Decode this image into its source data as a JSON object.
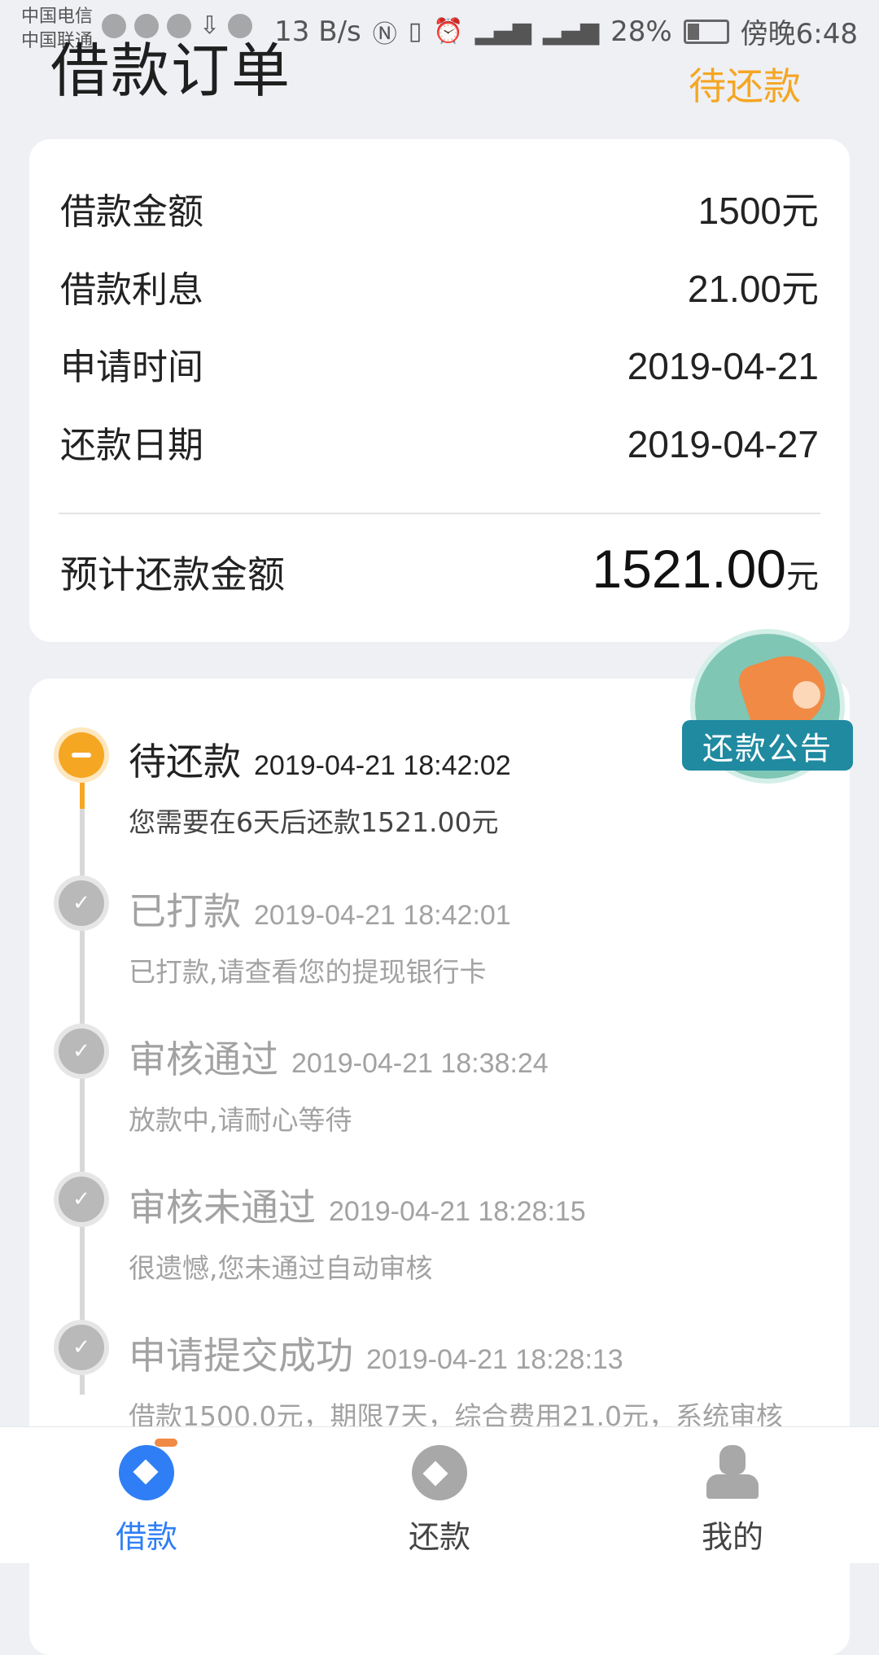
{
  "status_bar": {
    "carrier_1": "中国电信",
    "carrier_2": "中国联通",
    "net_speed": "13 B/s",
    "battery": "28%",
    "time": "傍晚6:48"
  },
  "header": {
    "title": "借款订单",
    "status": "待还款"
  },
  "summary": {
    "rows": [
      {
        "label": "借款金额",
        "value": "1500元"
      },
      {
        "label": "借款利息",
        "value": "21.00元"
      },
      {
        "label": "申请时间",
        "value": "2019-04-21"
      },
      {
        "label": "还款日期",
        "value": "2019-04-27"
      }
    ],
    "total_label": "预计还款金额",
    "total_value": "1521.00",
    "total_unit": "元"
  },
  "announcement": {
    "label": "还款公告"
  },
  "timeline": [
    {
      "title": "待还款",
      "time": "2019-04-21 18:42:02",
      "desc": "您需要在6天后还款1521.00元",
      "state": "current"
    },
    {
      "title": "已打款",
      "time": "2019-04-21 18:42:01",
      "desc": "已打款,请查看您的提现银行卡",
      "state": "done"
    },
    {
      "title": "审核通过",
      "time": "2019-04-21 18:38:24",
      "desc": "放款中,请耐心等待",
      "state": "done"
    },
    {
      "title": "审核未通过",
      "time": "2019-04-21 18:28:15",
      "desc": "很遗憾,您未通过自动审核",
      "state": "done"
    },
    {
      "title": "申请提交成功",
      "time": "2019-04-21 18:28:13",
      "desc": "借款1500.0元，期限7天，综合费用21.0元，系统审核",
      "state": "done"
    }
  ],
  "bottom_nav": [
    {
      "label": "借款",
      "icon": "borrow-icon",
      "active": true
    },
    {
      "label": "还款",
      "icon": "repay-icon",
      "active": false
    },
    {
      "label": "我的",
      "icon": "person-icon",
      "active": false
    }
  ],
  "colors": {
    "accent_orange": "#f5a623",
    "accent_blue": "#2f7ef5",
    "muted_gray": "#a2a2a2"
  }
}
